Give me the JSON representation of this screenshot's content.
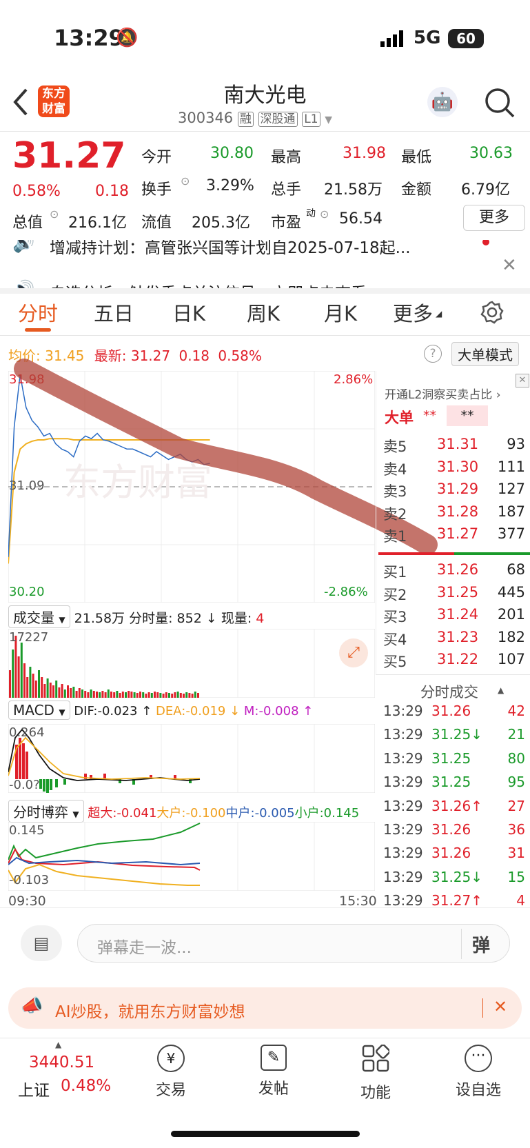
{
  "status": {
    "time": "13:29",
    "network": "5G",
    "battery": "60"
  },
  "header": {
    "title": "南大光电",
    "code": "300346",
    "badges": [
      "融",
      "深股通",
      "L1"
    ],
    "logo": "东方财富"
  },
  "quote": {
    "price": "31.27",
    "pct": "0.58%",
    "chg": "0.18",
    "open_l": "今开",
    "open": "30.80",
    "high_l": "最高",
    "high": "31.98",
    "low_l": "最低",
    "low": "30.63",
    "turn_l": "换手",
    "turn": "3.29%",
    "vol_l": "总手",
    "vol": "21.58万",
    "amt_l": "金额",
    "amt": "6.79亿",
    "cap_l": "总值",
    "cap": "216.1亿",
    "fcap_l": "流值",
    "fcap": "205.3亿",
    "pe_l": "市盈",
    "pe_sup": "动",
    "pe": "56.54",
    "more": "更多"
  },
  "news": {
    "line1": "增减持计划：高管张兴国等计划自2025-07-18起...",
    "line2": "自选分析：触发重点关注信号，立即点击查看"
  },
  "tabs": [
    "分时",
    "五日",
    "日K",
    "周K",
    "月K",
    "更多"
  ],
  "chart_info": {
    "avg_l": "均价:",
    "avg": "31.45",
    "last_l": "最新:",
    "last": "31.27",
    "chg": "0.18",
    "pct": "0.58%",
    "mode": "大单模式"
  },
  "chart_data": {
    "type": "line",
    "x_start": "09:30",
    "x_end": "15:30",
    "ylim": [
      30.2,
      31.98
    ],
    "y_high": "31.98",
    "y_mid": "31.09",
    "y_low": "30.20",
    "pct_high": "2.86%",
    "pct_low": "-2.86%",
    "series": [
      {
        "color": "#2a6bc4",
        "values": [
          30.55,
          31.55,
          31.95,
          31.7,
          31.6,
          31.55,
          31.48,
          31.5,
          31.42,
          31.38,
          31.36,
          31.32,
          31.44,
          31.48,
          31.46,
          31.5,
          31.45,
          31.44,
          31.42,
          31.4,
          31.38,
          31.38,
          31.36,
          31.34,
          31.32,
          31.36,
          31.33,
          31.3,
          31.32,
          31.34,
          31.3,
          31.28,
          31.3,
          31.26,
          31.27
        ]
      },
      {
        "color": "#f0b020",
        "values": [
          30.5,
          31.2,
          31.38,
          31.42,
          31.44,
          31.45,
          31.45,
          31.46,
          31.46,
          31.46,
          31.46,
          31.45,
          31.45,
          31.45,
          31.45,
          31.45,
          31.45,
          31.45,
          31.45,
          31.45,
          31.45,
          31.45,
          31.45,
          31.45,
          31.45,
          31.45,
          31.45,
          31.45,
          31.45,
          31.45,
          31.45,
          31.45,
          31.45,
          31.45,
          31.45
        ]
      }
    ]
  },
  "volume": {
    "label": "成交量",
    "total": "21.58万",
    "tick_l": "分时量:",
    "tick": "852 ↓",
    "now_l": "现量:",
    "now": "4",
    "max": "17227"
  },
  "macd": {
    "label": "MACD",
    "dif": "DIF:-0.023 ↑",
    "dea": "DEA:-0.019 ↓",
    "m": "M:-0.008 ↑",
    "top": "0.264",
    "bottom": "-0.0?"
  },
  "game": {
    "label": "分时博弈",
    "cd": "超大:-0.041",
    "dh": "大户:-0.100",
    "zh": "中户:-0.005",
    "xh": "小户:0.145",
    "top": "0.145",
    "bottom": "-0.103"
  },
  "time_axis": {
    "start": "09:30",
    "end": "15:30"
  },
  "depth": {
    "promo": "开通L2洞察买卖占比",
    "big_l": "大单",
    "big_v1": "**",
    "big_v2": "**",
    "asks": [
      {
        "l": "卖5",
        "p": "31.31",
        "v": "93"
      },
      {
        "l": "卖4",
        "p": "31.30",
        "v": "111"
      },
      {
        "l": "卖3",
        "p": "31.29",
        "v": "127"
      },
      {
        "l": "卖2",
        "p": "31.28",
        "v": "187"
      },
      {
        "l": "卖1",
        "p": "31.27",
        "v": "377"
      }
    ],
    "bids": [
      {
        "l": "买1",
        "p": "31.26",
        "v": "68"
      },
      {
        "l": "买2",
        "p": "31.25",
        "v": "445"
      },
      {
        "l": "买3",
        "p": "31.24",
        "v": "201"
      },
      {
        "l": "买4",
        "p": "31.23",
        "v": "182"
      },
      {
        "l": "买5",
        "p": "31.22",
        "v": "107"
      }
    ]
  },
  "ticks": {
    "title": "分时成交",
    "rows": [
      {
        "t": "13:29",
        "p": "31.26",
        "v": "42",
        "c": "red"
      },
      {
        "t": "13:29",
        "p": "31.25↓",
        "v": "21",
        "c": "green"
      },
      {
        "t": "13:29",
        "p": "31.25",
        "v": "80",
        "c": "green"
      },
      {
        "t": "13:29",
        "p": "31.25",
        "v": "95",
        "c": "green"
      },
      {
        "t": "13:29",
        "p": "31.26↑",
        "v": "27",
        "c": "red"
      },
      {
        "t": "13:29",
        "p": "31.26",
        "v": "36",
        "c": "red"
      },
      {
        "t": "13:29",
        "p": "31.26",
        "v": "31",
        "c": "red"
      },
      {
        "t": "13:29",
        "p": "31.25↓",
        "v": "15",
        "c": "green"
      },
      {
        "t": "13:29",
        "p": "31.27↑",
        "v": "4",
        "c": "red"
      }
    ]
  },
  "comment": {
    "placeholder": "弹幕走一波...",
    "btn": "弹"
  },
  "ad": {
    "text": "AI炒股，就用东方财富妙想"
  },
  "bottom": {
    "index_val": "3440.51",
    "index_name": "上证",
    "index_pct": "0.48%",
    "items": [
      "交易",
      "发帖",
      "功能",
      "设自选"
    ]
  }
}
